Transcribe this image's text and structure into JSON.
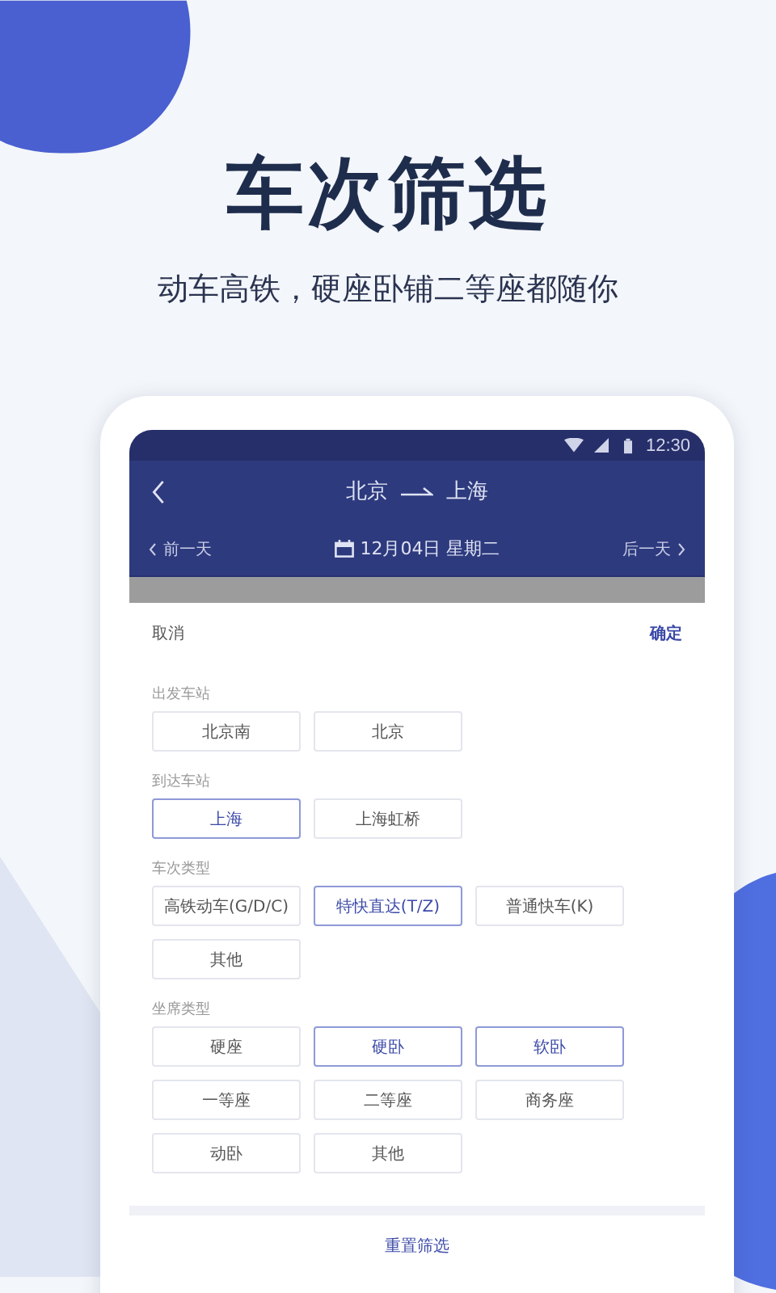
{
  "headline": {
    "title": "车次筛选",
    "subtitle": "动车高铁，硬座卧铺二等座都随你"
  },
  "status_bar": {
    "time": "12:30"
  },
  "header": {
    "from": "北京",
    "to": "上海",
    "prev_day": "前一天",
    "date": "12月04日 星期二",
    "next_day": "后一天"
  },
  "sheet": {
    "cancel": "取消",
    "confirm": "确定",
    "sections": [
      {
        "title": "出发车站",
        "options": [
          {
            "label": "北京南",
            "selected": false
          },
          {
            "label": "北京",
            "selected": false
          }
        ]
      },
      {
        "title": "到达车站",
        "options": [
          {
            "label": "上海",
            "selected": true
          },
          {
            "label": "上海虹桥",
            "selected": false
          }
        ]
      },
      {
        "title": "车次类型",
        "options": [
          {
            "label": "高铁动车(G/D/C)",
            "selected": false
          },
          {
            "label": "特快直达(T/Z)",
            "selected": true
          },
          {
            "label": "普通快车(K)",
            "selected": false
          },
          {
            "label": "其他",
            "selected": false
          }
        ]
      },
      {
        "title": "坐席类型",
        "options": [
          {
            "label": "硬座",
            "selected": false
          },
          {
            "label": "硬卧",
            "selected": true
          },
          {
            "label": "软卧",
            "selected": true
          },
          {
            "label": "一等座",
            "selected": false
          },
          {
            "label": "二等座",
            "selected": false
          },
          {
            "label": "商务座",
            "selected": false
          },
          {
            "label": "动卧",
            "selected": false
          },
          {
            "label": "其他",
            "selected": false
          }
        ]
      }
    ],
    "reset": "重置筛选"
  }
}
